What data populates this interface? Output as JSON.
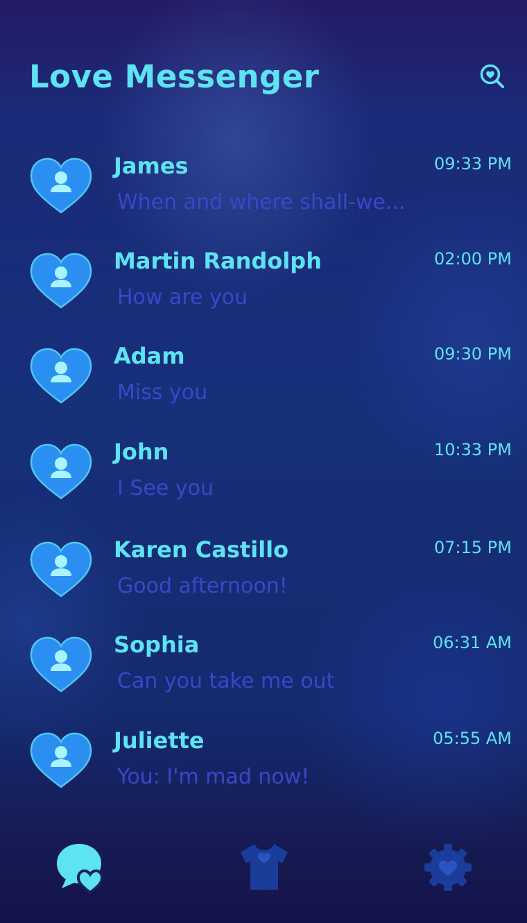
{
  "app": {
    "title": "Love Messenger"
  },
  "header": {
    "search_icon": "heart-search-icon"
  },
  "conversations": [
    {
      "name": "James",
      "message": "When and where shall-we...",
      "time": "09:33 PM"
    },
    {
      "name": "Martin Randolph",
      "message": "How are you",
      "time": "02:00 PM"
    },
    {
      "name": "Adam",
      "message": "Miss you",
      "time": "09:30 PM"
    },
    {
      "name": "John",
      "message": "I See you",
      "time": "10:33 PM"
    },
    {
      "name": "Karen Castillo",
      "message": "Good afternoon!",
      "time": "07:15 PM"
    },
    {
      "name": "Sophia",
      "message": "Can you take me out",
      "time": "06:31 AM"
    },
    {
      "name": "Juliette",
      "message": "You: I'm mad now!",
      "time": "05:55 AM"
    }
  ],
  "bottom_nav": {
    "items": [
      {
        "icon": "chat-heart-icon",
        "active": true
      },
      {
        "icon": "tshirt-heart-icon",
        "active": false
      },
      {
        "icon": "gear-heart-icon",
        "active": false
      }
    ]
  },
  "colors": {
    "accent": "#5de3f2",
    "message_text": "#3a47c8",
    "heart_fill": "#2a8ff0",
    "inactive_icon": "#1a3d9a"
  }
}
